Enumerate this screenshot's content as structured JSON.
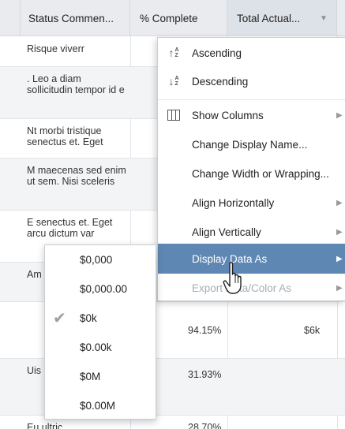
{
  "columns": {
    "status": "Status Commen...",
    "pct": "% Complete",
    "total": "Total Actual..."
  },
  "rows": [
    {
      "status": "Risque viverr",
      "pct": "",
      "total": ""
    },
    {
      "status": ". Leo a diam sollicitudin tempor id e",
      "pct": "",
      "total": ""
    },
    {
      "status": "Nt morbi tristique senectus et. Eget",
      "pct": "",
      "total": ""
    },
    {
      "status": "M maecenas sed enim ut sem. Nisi sceleris",
      "pct": "",
      "total": ""
    },
    {
      "status": "E senectus et. Eget arcu dictum var",
      "pct": "",
      "total": ""
    },
    {
      "status": "Am",
      "pct": "",
      "total": ""
    },
    {
      "status": "",
      "pct": "94.15%",
      "total": "$6k"
    },
    {
      "status": "Uis sce fer",
      "pct": "31.93%",
      "total": ""
    },
    {
      "status": "Eu ultric",
      "pct": "28.70%",
      "total": ""
    }
  ],
  "column_menu": {
    "ascending": "Ascending",
    "descending": "Descending",
    "show_columns": "Show Columns",
    "change_display_name": "Change Display Name...",
    "change_width": "Change Width or Wrapping...",
    "align_horizontally": "Align Horizontally",
    "align_vertically": "Align Vertically",
    "display_data_as": "Display Data As",
    "export_data_as": "Export Data/Color As"
  },
  "format_menu": {
    "options": [
      "$0,000",
      "$0,000.00",
      "$0k",
      "$0.00k",
      "$0M",
      "$0.00M"
    ],
    "selected": "$0k"
  },
  "colors": {
    "highlight": "#5f87b4",
    "header_bg": "#e9ebee"
  }
}
